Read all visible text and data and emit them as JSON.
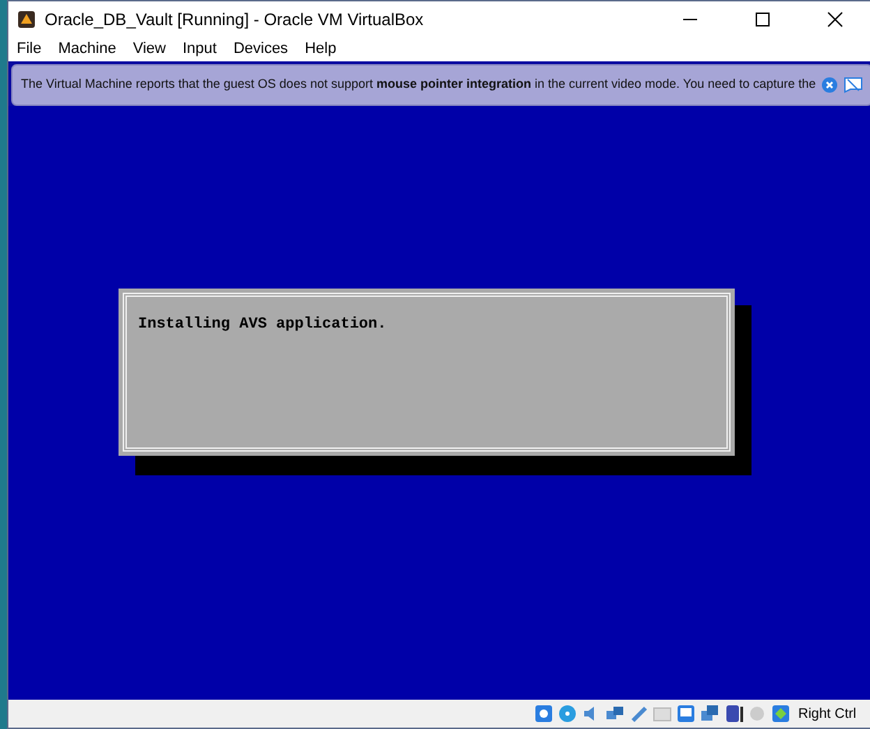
{
  "window": {
    "title": "Oracle_DB_Vault [Running] - Oracle VM VirtualBox"
  },
  "menu": [
    "File",
    "Machine",
    "View",
    "Input",
    "Devices",
    "Help"
  ],
  "notification": {
    "message": "The Virtual Machine reports that the guest OS does not support **mouse pointer integration** in the current video mode. You need to capture the"
  },
  "vm_screen": {
    "dialog": {
      "text": "Installing AVS application."
    }
  },
  "status_bar": {
    "host_key": "Right Ctrl"
  }
}
